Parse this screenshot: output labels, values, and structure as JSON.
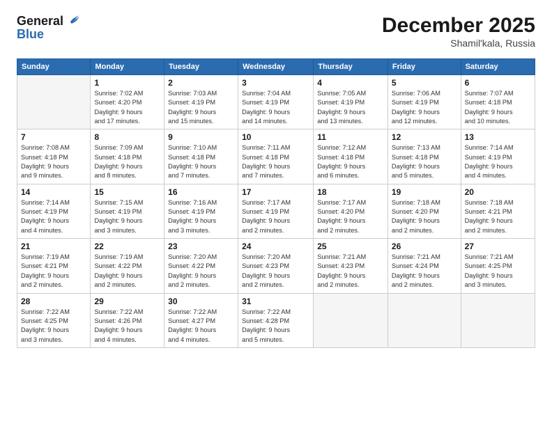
{
  "logo": {
    "line1": "General",
    "line2": "Blue"
  },
  "header": {
    "month": "December 2025",
    "location": "Shamil'kala, Russia"
  },
  "weekdays": [
    "Sunday",
    "Monday",
    "Tuesday",
    "Wednesday",
    "Thursday",
    "Friday",
    "Saturday"
  ],
  "weeks": [
    [
      {
        "day": "",
        "info": ""
      },
      {
        "day": "1",
        "info": "Sunrise: 7:02 AM\nSunset: 4:20 PM\nDaylight: 9 hours\nand 17 minutes."
      },
      {
        "day": "2",
        "info": "Sunrise: 7:03 AM\nSunset: 4:19 PM\nDaylight: 9 hours\nand 15 minutes."
      },
      {
        "day": "3",
        "info": "Sunrise: 7:04 AM\nSunset: 4:19 PM\nDaylight: 9 hours\nand 14 minutes."
      },
      {
        "day": "4",
        "info": "Sunrise: 7:05 AM\nSunset: 4:19 PM\nDaylight: 9 hours\nand 13 minutes."
      },
      {
        "day": "5",
        "info": "Sunrise: 7:06 AM\nSunset: 4:19 PM\nDaylight: 9 hours\nand 12 minutes."
      },
      {
        "day": "6",
        "info": "Sunrise: 7:07 AM\nSunset: 4:18 PM\nDaylight: 9 hours\nand 10 minutes."
      }
    ],
    [
      {
        "day": "7",
        "info": "Sunrise: 7:08 AM\nSunset: 4:18 PM\nDaylight: 9 hours\nand 9 minutes."
      },
      {
        "day": "8",
        "info": "Sunrise: 7:09 AM\nSunset: 4:18 PM\nDaylight: 9 hours\nand 8 minutes."
      },
      {
        "day": "9",
        "info": "Sunrise: 7:10 AM\nSunset: 4:18 PM\nDaylight: 9 hours\nand 7 minutes."
      },
      {
        "day": "10",
        "info": "Sunrise: 7:11 AM\nSunset: 4:18 PM\nDaylight: 9 hours\nand 7 minutes."
      },
      {
        "day": "11",
        "info": "Sunrise: 7:12 AM\nSunset: 4:18 PM\nDaylight: 9 hours\nand 6 minutes."
      },
      {
        "day": "12",
        "info": "Sunrise: 7:13 AM\nSunset: 4:18 PM\nDaylight: 9 hours\nand 5 minutes."
      },
      {
        "day": "13",
        "info": "Sunrise: 7:14 AM\nSunset: 4:19 PM\nDaylight: 9 hours\nand 4 minutes."
      }
    ],
    [
      {
        "day": "14",
        "info": "Sunrise: 7:14 AM\nSunset: 4:19 PM\nDaylight: 9 hours\nand 4 minutes."
      },
      {
        "day": "15",
        "info": "Sunrise: 7:15 AM\nSunset: 4:19 PM\nDaylight: 9 hours\nand 3 minutes."
      },
      {
        "day": "16",
        "info": "Sunrise: 7:16 AM\nSunset: 4:19 PM\nDaylight: 9 hours\nand 3 minutes."
      },
      {
        "day": "17",
        "info": "Sunrise: 7:17 AM\nSunset: 4:19 PM\nDaylight: 9 hours\nand 2 minutes."
      },
      {
        "day": "18",
        "info": "Sunrise: 7:17 AM\nSunset: 4:20 PM\nDaylight: 9 hours\nand 2 minutes."
      },
      {
        "day": "19",
        "info": "Sunrise: 7:18 AM\nSunset: 4:20 PM\nDaylight: 9 hours\nand 2 minutes."
      },
      {
        "day": "20",
        "info": "Sunrise: 7:18 AM\nSunset: 4:21 PM\nDaylight: 9 hours\nand 2 minutes."
      }
    ],
    [
      {
        "day": "21",
        "info": "Sunrise: 7:19 AM\nSunset: 4:21 PM\nDaylight: 9 hours\nand 2 minutes."
      },
      {
        "day": "22",
        "info": "Sunrise: 7:19 AM\nSunset: 4:22 PM\nDaylight: 9 hours\nand 2 minutes."
      },
      {
        "day": "23",
        "info": "Sunrise: 7:20 AM\nSunset: 4:22 PM\nDaylight: 9 hours\nand 2 minutes."
      },
      {
        "day": "24",
        "info": "Sunrise: 7:20 AM\nSunset: 4:23 PM\nDaylight: 9 hours\nand 2 minutes."
      },
      {
        "day": "25",
        "info": "Sunrise: 7:21 AM\nSunset: 4:23 PM\nDaylight: 9 hours\nand 2 minutes."
      },
      {
        "day": "26",
        "info": "Sunrise: 7:21 AM\nSunset: 4:24 PM\nDaylight: 9 hours\nand 2 minutes."
      },
      {
        "day": "27",
        "info": "Sunrise: 7:21 AM\nSunset: 4:25 PM\nDaylight: 9 hours\nand 3 minutes."
      }
    ],
    [
      {
        "day": "28",
        "info": "Sunrise: 7:22 AM\nSunset: 4:25 PM\nDaylight: 9 hours\nand 3 minutes."
      },
      {
        "day": "29",
        "info": "Sunrise: 7:22 AM\nSunset: 4:26 PM\nDaylight: 9 hours\nand 4 minutes."
      },
      {
        "day": "30",
        "info": "Sunrise: 7:22 AM\nSunset: 4:27 PM\nDaylight: 9 hours\nand 4 minutes."
      },
      {
        "day": "31",
        "info": "Sunrise: 7:22 AM\nSunset: 4:28 PM\nDaylight: 9 hours\nand 5 minutes."
      },
      {
        "day": "",
        "info": ""
      },
      {
        "day": "",
        "info": ""
      },
      {
        "day": "",
        "info": ""
      }
    ]
  ]
}
